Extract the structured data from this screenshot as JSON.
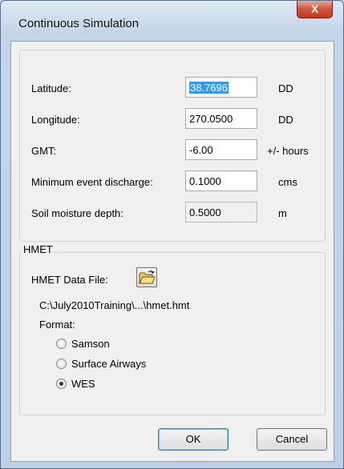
{
  "window": {
    "title": "Continuous Simulation",
    "close_label": "X"
  },
  "params": {
    "latitude": {
      "label": "Latitude:",
      "value": "38.7696",
      "unit": "DD"
    },
    "longitude": {
      "label": "Longitude:",
      "value": "270.0500",
      "unit": "DD"
    },
    "gmt": {
      "label": "GMT:",
      "value": "-6.00",
      "unit": "+/- hours"
    },
    "min_discharge": {
      "label": "Minimum event discharge:",
      "value": "0.1000",
      "unit": "cms"
    },
    "soil_moisture": {
      "label": "Soil moisture depth:",
      "value": "0.5000",
      "unit": "m"
    }
  },
  "hmet": {
    "group_title": "HMET",
    "data_file_label": "HMET Data File:",
    "file_path": "C:\\July2010Training\\...\\hmet.hmt",
    "format_label": "Format:",
    "options": [
      {
        "label": "Samson",
        "checked": false
      },
      {
        "label": "Surface Airways",
        "checked": false
      },
      {
        "label": "WES",
        "checked": true
      }
    ]
  },
  "buttons": {
    "ok": "OK",
    "cancel": "Cancel"
  }
}
